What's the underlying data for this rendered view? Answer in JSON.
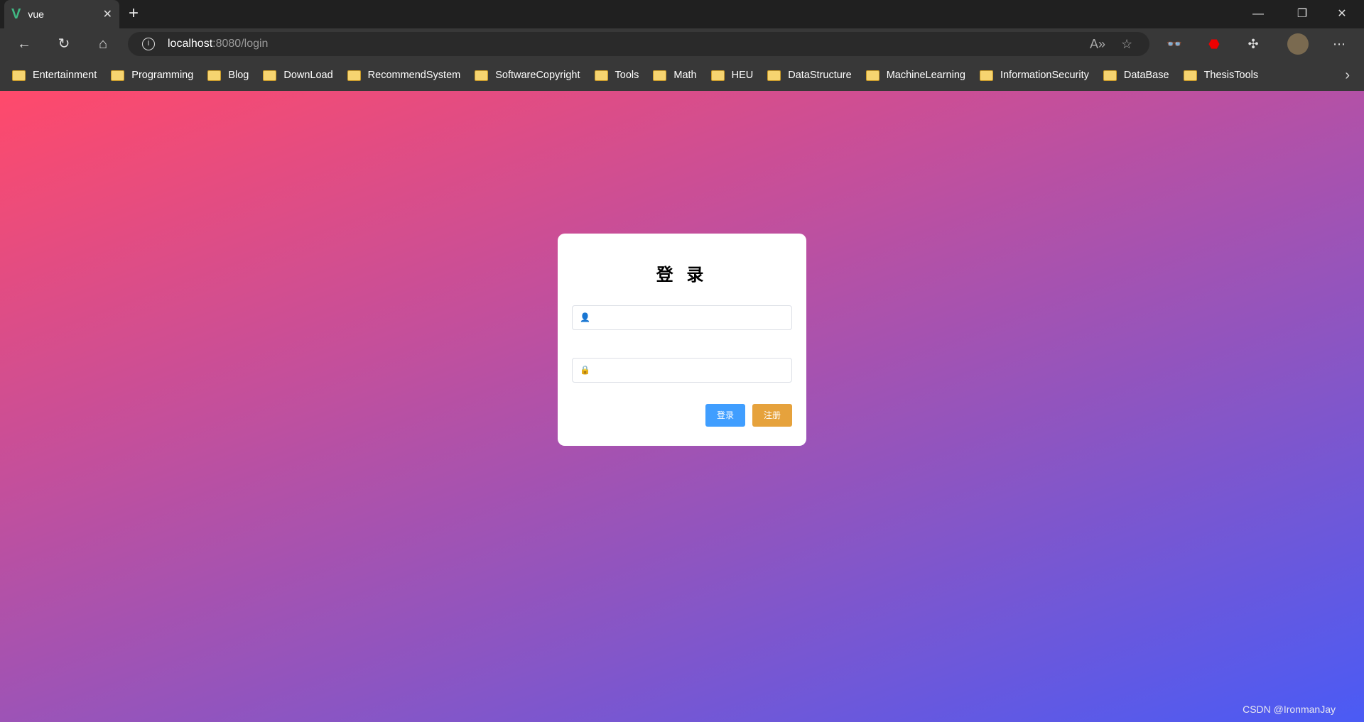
{
  "browser": {
    "tab_title": "vue",
    "url_host": "localhost",
    "url_path": ":8080/login",
    "bookmarks": [
      "Entertainment",
      "Programming",
      "Blog",
      "DownLoad",
      "RecommendSystem",
      "SoftwareCopyright",
      "Tools",
      "Math",
      "HEU",
      "DataStructure",
      "MachineLearning",
      "InformationSecurity",
      "DataBase",
      "ThesisTools"
    ]
  },
  "login": {
    "title": "登 录",
    "username_value": "",
    "password_value": "",
    "login_label": "登录",
    "register_label": "注册",
    "login_color": "#409eff",
    "register_color": "#e6a23c"
  },
  "watermark": "CSDN @IronmanJay"
}
